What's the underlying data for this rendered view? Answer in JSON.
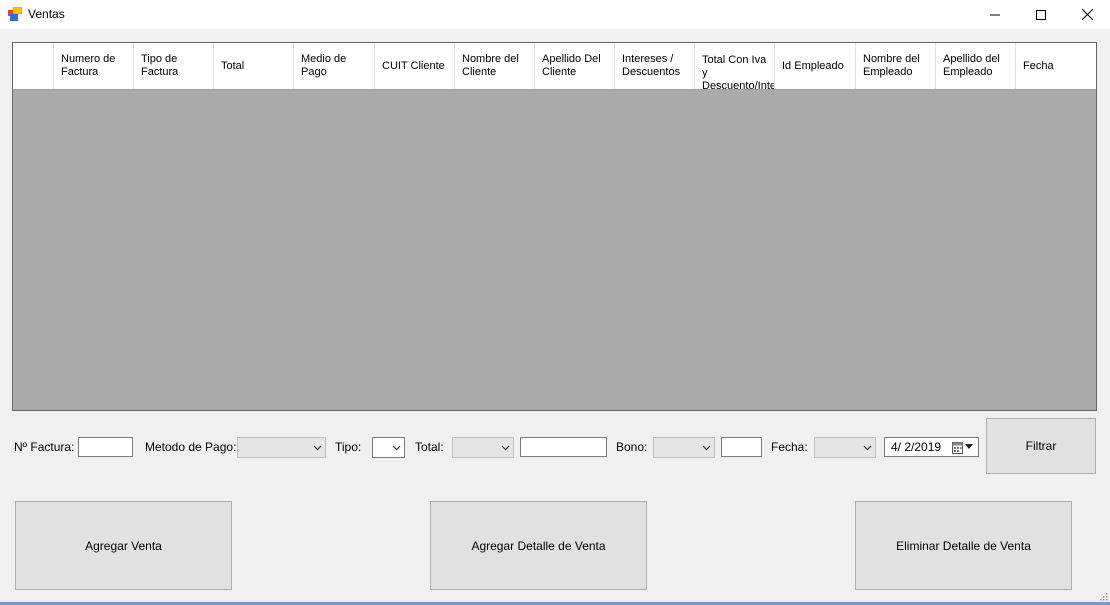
{
  "window": {
    "title": "Ventas",
    "minimize_glyph": "—",
    "maximize_glyph": "☐",
    "close_glyph": "✕"
  },
  "grid": {
    "columns": [
      "",
      "Numero de Factura",
      "Tipo de Factura",
      "Total",
      "Medio de Pago",
      "CUIT Cliente",
      "Nombre del Cliente",
      "Apellido Del Cliente",
      "Intereses / Descuentos",
      "Total Con Iva y Descuento/Interes",
      "Id Empleado",
      "Nombre del Empleado",
      "Apellido del Empleado",
      "Fecha"
    ],
    "rows": []
  },
  "filters": {
    "factura_label": "Nº Factura:",
    "factura_value": "",
    "metodo_pago_label": "Metodo de Pago:",
    "metodo_pago_value": "",
    "tipo_label": "Tipo:",
    "tipo_value": "",
    "total_label": "Total:",
    "total_operator": "",
    "total_value": "",
    "bono_label": "Bono:",
    "bono_operator": "",
    "bono_value": "",
    "fecha_label": "Fecha:",
    "fecha_operator": "",
    "fecha_value": "4/ 2/2019",
    "filtrar_label": "Filtrar"
  },
  "actions": {
    "agregar_venta": "Agregar Venta",
    "agregar_detalle": "Agregar Detalle de Venta",
    "eliminar_detalle": "Eliminar Detalle de Venta"
  },
  "icons": {
    "app": "app-icon",
    "dropdown": "chevron-down-icon",
    "calendar": "calendar-icon"
  },
  "colors": {
    "window_bg": "#f0f0f0",
    "grid_bg": "#ababab",
    "header_bg": "#ffffff",
    "button_bg": "#e1e1e1"
  }
}
